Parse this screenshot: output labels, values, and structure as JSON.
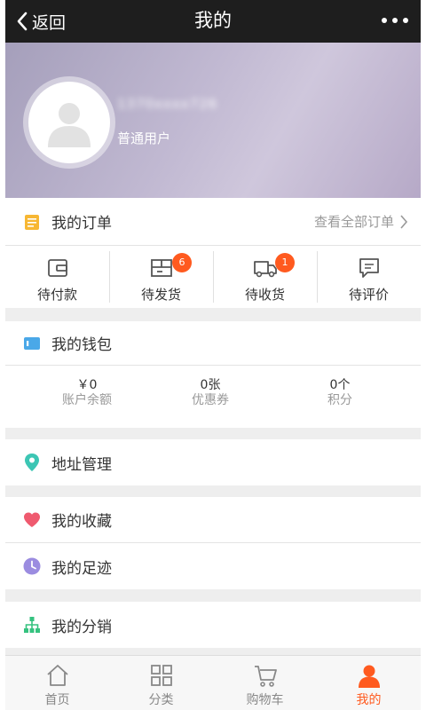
{
  "header": {
    "back_label": "返回",
    "title": "我的"
  },
  "profile": {
    "username": "1370xxxx726",
    "user_type": "普通用户"
  },
  "orders": {
    "title": "我的订单",
    "view_all": "查看全部订单",
    "status": [
      {
        "label": "待付款",
        "icon": "wallet-icon",
        "badge": ""
      },
      {
        "label": "待发货",
        "icon": "package-icon",
        "badge": "6"
      },
      {
        "label": "待收货",
        "icon": "truck-icon",
        "badge": "1"
      },
      {
        "label": "待评价",
        "icon": "comment-icon",
        "badge": ""
      }
    ]
  },
  "wallet": {
    "title": "我的钱包",
    "stats": [
      {
        "value": "￥0",
        "label": "账户余额"
      },
      {
        "value": "0张",
        "label": "优惠券"
      },
      {
        "value": "0个",
        "label": "积分"
      }
    ]
  },
  "menu": {
    "address": "地址管理",
    "favorites": "我的收藏",
    "footprint": "我的足迹",
    "distribution": "我的分销"
  },
  "tabbar": {
    "items": [
      {
        "label": "首页",
        "icon": "home-icon"
      },
      {
        "label": "分类",
        "icon": "grid-icon"
      },
      {
        "label": "购物车",
        "icon": "cart-icon"
      },
      {
        "label": "我的",
        "icon": "user-icon"
      }
    ],
    "active_index": 3
  },
  "colors": {
    "accent": "#ff5a1f",
    "topbar": "#1e1e1e",
    "address_icon": "#3cc6b4",
    "favorites_icon": "#ef5a6f",
    "footprint_icon": "#9b8ce0",
    "distribution_icon": "#35c27f",
    "order_icon": "#f7b733",
    "wallet_icon": "#4aa8e8"
  }
}
